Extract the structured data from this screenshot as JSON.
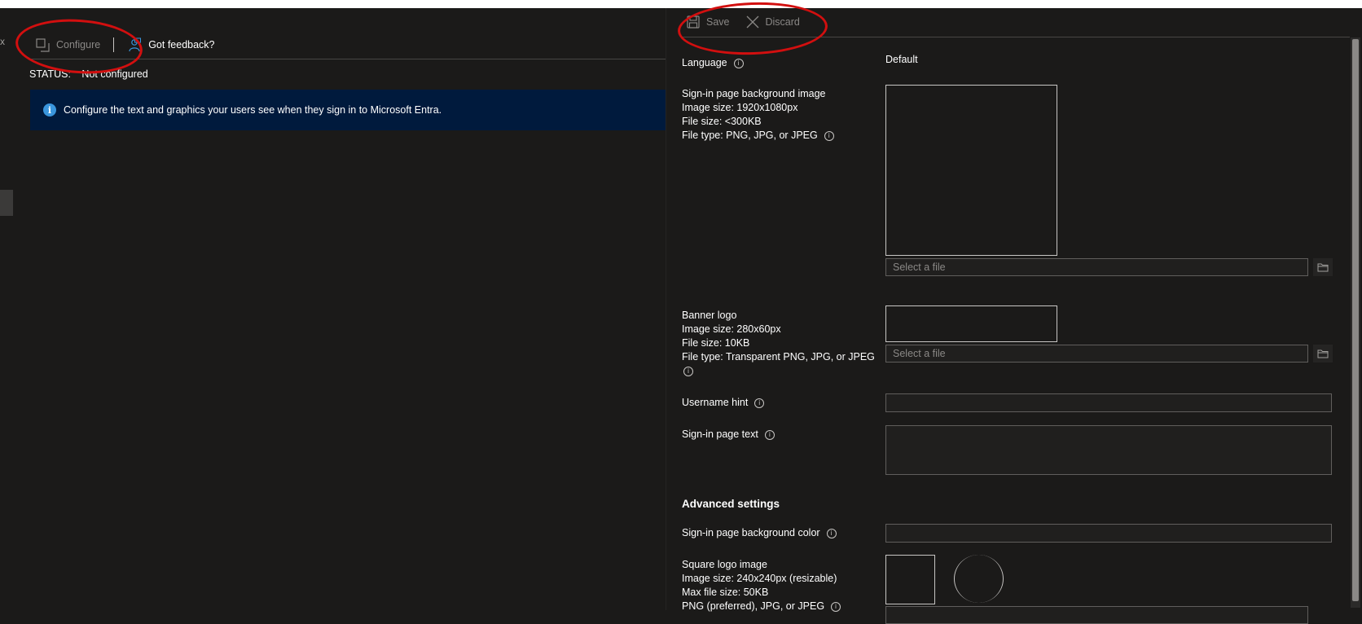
{
  "left_blade": {
    "close_glyph": "x",
    "toolbar": {
      "configure_label": "Configure",
      "feedback_label": "Got feedback?"
    },
    "status": {
      "key": "STATUS:",
      "value": "Not configured"
    },
    "info_banner": {
      "icon": "info-icon",
      "text": "Configure the text and graphics your users see when they sign in to Microsoft Entra."
    }
  },
  "panel": {
    "toolbar": {
      "save_label": "Save",
      "discard_label": "Discard"
    },
    "language": {
      "label": "Language",
      "value": "Default"
    },
    "background_image": {
      "title": "Sign-in page background image",
      "size": "Image size: 1920x1080px",
      "file_size": "File size: <300KB",
      "file_type": "File type: PNG, JPG, or JPEG",
      "placeholder": "Select a file"
    },
    "banner_logo": {
      "title": "Banner logo",
      "size": "Image size: 280x60px",
      "file_size": "File size: 10KB",
      "file_type": "File type: Transparent PNG, JPG, or JPEG",
      "placeholder": "Select a file"
    },
    "username_hint": {
      "label": "Username hint",
      "value": ""
    },
    "signin_text": {
      "label": "Sign-in page text",
      "value": ""
    },
    "advanced": {
      "heading": "Advanced settings",
      "bg_color_label": "Sign-in page background color",
      "square_logo": {
        "title": "Square logo image",
        "size": "Image size: 240x240px (resizable)",
        "max_size": "Max file size: 50KB",
        "file_type": "PNG (preferred), JPG, or JPEG"
      }
    }
  },
  "colors": {
    "background": "#1b1a19",
    "info_banner": "#001a3d",
    "info_icon": "#3a96dd",
    "annotation": "#d20f0f"
  }
}
